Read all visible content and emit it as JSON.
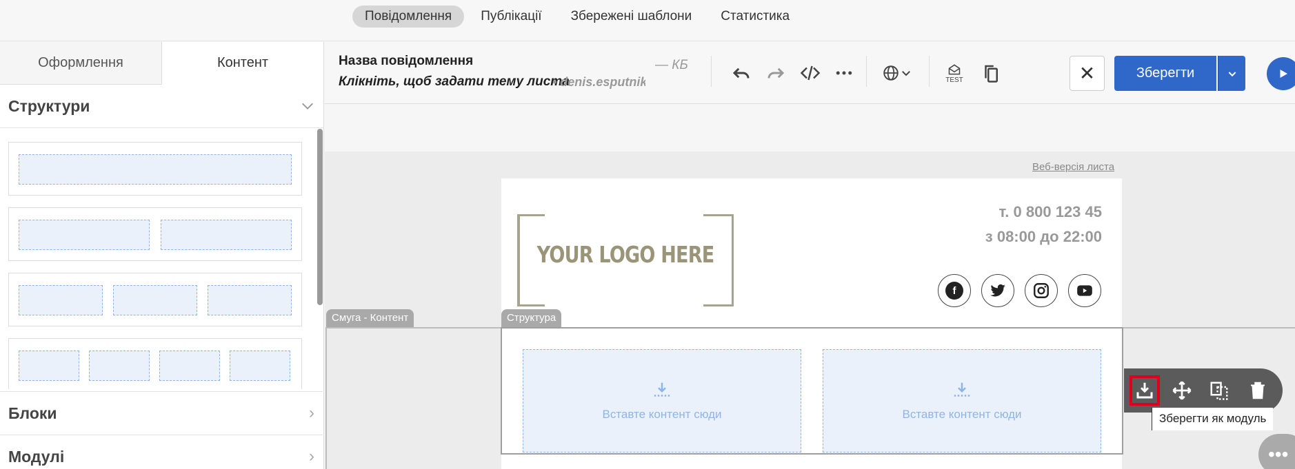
{
  "topnav": {
    "tabs": [
      {
        "label": "Повідомлення",
        "active": true
      },
      {
        "label": "Публікації",
        "active": false
      },
      {
        "label": "Збережені шаблони",
        "active": false
      },
      {
        "label": "Статистика",
        "active": false
      }
    ]
  },
  "left_panel": {
    "tabs": [
      {
        "label": "Оформлення",
        "active": false
      },
      {
        "label": "Контент",
        "active": true
      }
    ],
    "structures_title": "Структури",
    "blocks_title": "Блоки",
    "modules_title": "Модулі"
  },
  "toolbar": {
    "message_name": "Назва повідомлення",
    "subject_placeholder": "Клікніть, щоб задати тему листа",
    "sender": "• denis.esputnik",
    "size": "— КБ",
    "test_label": "TEST",
    "save_label": "Зберегти",
    "close_symbol": "✕"
  },
  "canvas": {
    "web_version_link": "Веб-версія листа",
    "logo_text": "YOUR LOGO HERE",
    "phone_line": "т. 0 800 123 45",
    "hours_line": "з 08:00 до 22:00",
    "social_icons": [
      "facebook-icon",
      "twitter-icon",
      "instagram-icon",
      "youtube-icon"
    ],
    "row_label": "Смуга - Контент",
    "structure_label": "Структура",
    "dropzone_text": "Вставте контент сюди",
    "tooltip": "Зберегти як модуль"
  },
  "colors": {
    "accent": "#2f68c9",
    "highlight": "#e0001a",
    "dropzone_border": "#8fb5e6"
  }
}
